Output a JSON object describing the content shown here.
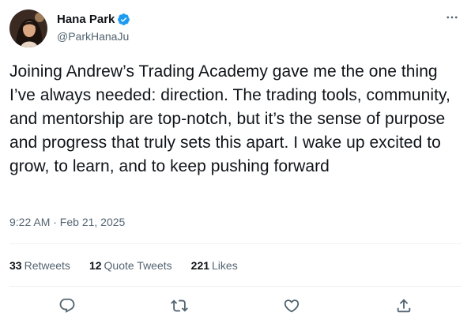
{
  "author": {
    "display_name": "Hana Park",
    "handle": "@ParkHanaJu",
    "verified": true
  },
  "tweet": {
    "text": "Joining Andrew’s Trading Academy gave me the one thing I’ve always needed: direction. The trading tools, community, and mentorship are top-notch, but it’s the sense of purpose and progress that truly sets this apart. I wake up excited to grow, to learn, and to keep pushing forward",
    "timestamp": "9:22 AM · Feb 21, 2025"
  },
  "stats": {
    "retweets_count": "33",
    "retweets_label": "Retweets",
    "quotes_count": "12",
    "quotes_label": "Quote Tweets",
    "likes_count": "221",
    "likes_label": "Likes"
  },
  "actions": [
    {
      "icon": "reply-icon"
    },
    {
      "icon": "retweet-icon"
    },
    {
      "icon": "like-icon"
    },
    {
      "icon": "share-icon"
    }
  ],
  "colors": {
    "text_primary": "#0f1419",
    "text_secondary": "#536471",
    "verified_blue": "#1d9bf0",
    "divider": "#eff3f4"
  }
}
